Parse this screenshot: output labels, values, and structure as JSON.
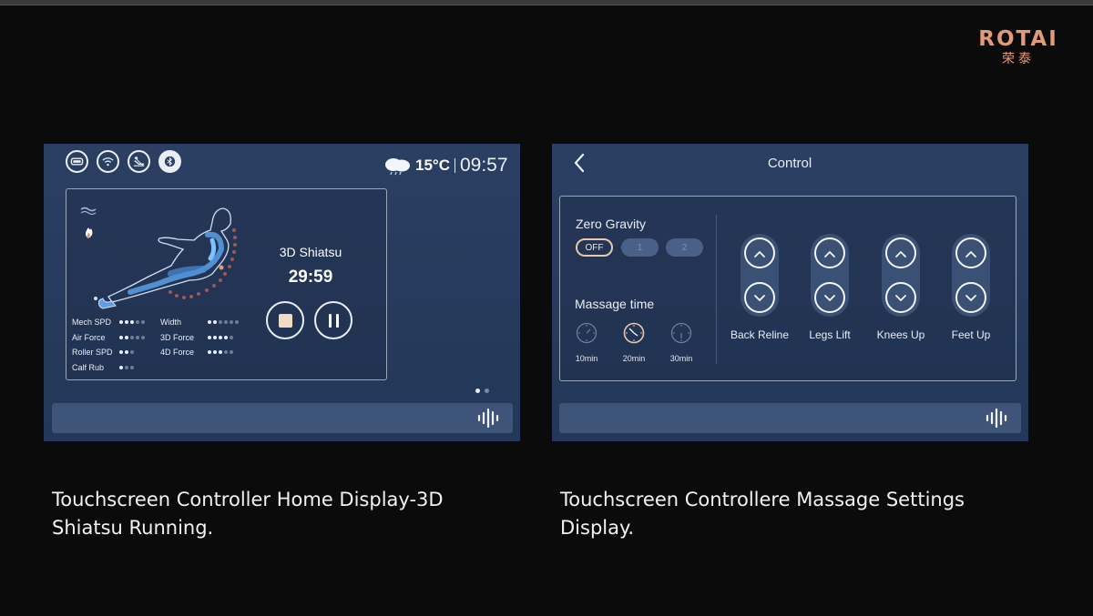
{
  "brand": {
    "name": "ROTAI",
    "name_cn": "荣泰",
    "color": "#e39a78"
  },
  "home": {
    "status_icons": [
      "battery-icon",
      "wifi-icon",
      "recline-icon",
      "bluetooth-avatar-icon"
    ],
    "temperature": "15°C",
    "time": "09:57",
    "program": "3D Shiatsu",
    "timer": "29:59",
    "stats": [
      {
        "label": "Mech SPD",
        "level": 3,
        "max": 5
      },
      {
        "label": "Air Force",
        "level": 2,
        "max": 5
      },
      {
        "label": "Roller SPD",
        "level": 2,
        "max": 3
      },
      {
        "label": "Calf Rub",
        "level": 1,
        "max": 3
      },
      {
        "label": "Width",
        "level": 2,
        "max": 6
      },
      {
        "label": "3D Force",
        "level": 4,
        "max": 5
      },
      {
        "label": "4D Force",
        "level": 3,
        "max": 5
      }
    ],
    "page_indicator": {
      "current": 1,
      "total": 2
    }
  },
  "control": {
    "title": "Control",
    "zero_gravity": {
      "label": "Zero Gravity",
      "options": [
        "OFF",
        "1",
        "2"
      ],
      "selected": "OFF"
    },
    "massage_time": {
      "label": "Massage time",
      "options": [
        "10min",
        "20min",
        "30min"
      ],
      "selected": "20min"
    },
    "adjusters": [
      "Back Reline",
      "Legs Lift",
      "Knees Up",
      "Feet Up"
    ]
  },
  "captions": {
    "left": "Touchscreen Controller Home Display-3D Shiatsu Running.",
    "right": "Touchscreen Controllere Massage Settings Display."
  }
}
